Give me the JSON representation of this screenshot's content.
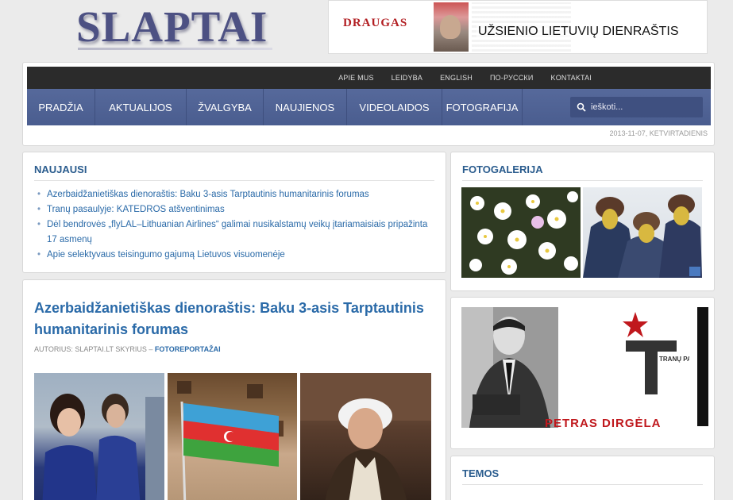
{
  "header": {
    "logo_text": "SLAPTAI",
    "banner": {
      "brand": "DRAUGAS",
      "tagline": "UŽSIENIO LIETUVIŲ DIENRAŠTIS"
    }
  },
  "topbar": {
    "links": [
      "APIE MUS",
      "LEIDYBA",
      "ENGLISH",
      "ПО-РУССКИ",
      "KONTAKTAI"
    ]
  },
  "mainnav": {
    "items": [
      {
        "label": "PRADŽIA",
        "width": 86
      },
      {
        "label": "AKTUALIJOS",
        "width": 115
      },
      {
        "label": "ŽVALGYBA",
        "width": 97
      },
      {
        "label": "NAUJIENOS",
        "width": 105
      },
      {
        "label": "VIDEOLAIDOS",
        "width": 120
      },
      {
        "label": "FOTOGRAFIJA",
        "width": 101
      }
    ],
    "search_placeholder": "ieškoti..."
  },
  "date": "2013-11-07, KETVIRTADIENIS",
  "latest": {
    "title": "NAUJAUSI",
    "items": [
      "Azerbaidžanietiškas dienoraštis: Baku 3-asis Tarptautinis humanitarinis forumas",
      "Tranų pasaulyje: KATEDROS atšventinimas",
      "Dėl bendrovės „flyLAL–Lithuanian Airlines“ galimai nusikalstamų veikų įtariamaisiais pripažinta 17 asmenų",
      "Apie selektyvaus teisingumo gajumą Lietuvos visuomenėje"
    ]
  },
  "article": {
    "title": "Azerbaidžanietiškas dienoraštis: Baku 3-asis Tarptautinis humanitarinis forumas",
    "byline_prefix": "AUTORIUS: SLAPTAI.LT SKYRIUS –",
    "category": "FOTOREPORTAŽAI"
  },
  "gallery": {
    "title": "FOTOGALERIJA"
  },
  "promo": {
    "name": "PETRAS DIRGĖLA",
    "logo_text": "TRANŲ PASAULYJE"
  },
  "topics": {
    "title": "TEMOS"
  },
  "colors": {
    "nav": "#4a5d8f",
    "link": "#2a6aa8",
    "title": "#2a5c8e",
    "accent_red": "#c0181d"
  }
}
